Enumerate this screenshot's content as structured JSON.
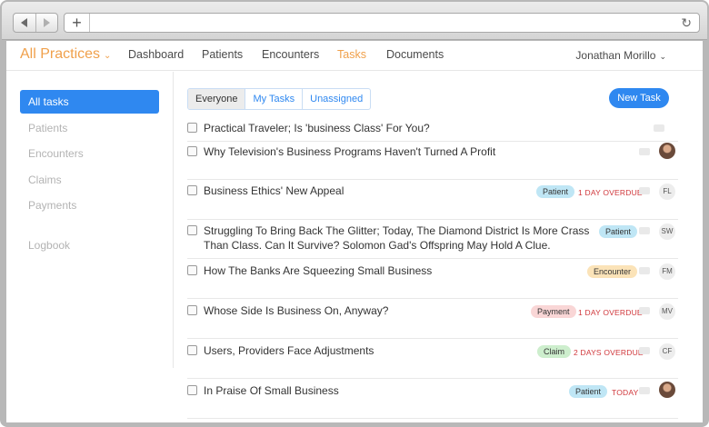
{
  "nav": {
    "brand": "All Practices",
    "items": [
      "Dashboard",
      "Patients",
      "Encounters",
      "Tasks",
      "Documents"
    ],
    "active": "Tasks",
    "user": "Jonathan Morillo"
  },
  "sidebar": {
    "items": [
      "All tasks",
      "Patients",
      "Encounters",
      "Claims",
      "Payments",
      "Logbook"
    ],
    "active": "All tasks"
  },
  "filters": [
    "Everyone",
    "My Tasks",
    "Unassigned"
  ],
  "new_task_label": "New Task",
  "tasks": [
    {
      "title": "Practical Traveler; Is 'business Class' For You?",
      "badge": "",
      "status": "",
      "assignee": ""
    },
    {
      "title": "Why Television's Business Programs Haven't Turned A Profit",
      "badge": "",
      "status": "",
      "assignee": "photo"
    },
    {
      "title": "Business Ethics' New Appeal",
      "badge": "Patient",
      "status": "1 DAY OVERDUE",
      "assignee": "FL"
    },
    {
      "title": "Struggling To Bring Back The Glitter; Today, The Diamond District Is More Crass Than Class. Can It Survive? Solomon Gad's Offspring May Hold A Clue.",
      "badge": "Patient",
      "status": "",
      "assignee": "SW"
    },
    {
      "title": "How The Banks Are Squeezing Small Business",
      "badge": "Encounter",
      "status": "",
      "assignee": "FM"
    },
    {
      "title": "Whose Side Is Business On, Anyway?",
      "badge": "Payment",
      "status": "1 DAY OVERDUE",
      "assignee": "MV"
    },
    {
      "title": "Users, Providers Face Adjustments",
      "badge": "Claim",
      "status": "2 DAYS OVERDUE",
      "assignee": "CF"
    },
    {
      "title": "In Praise Of Small Business",
      "badge": "Patient",
      "status": "TODAY",
      "assignee": "photo"
    }
  ],
  "colors": {
    "accent": "#2f88f0",
    "brand": "#f0a04b",
    "overdue": "#d0373b"
  }
}
